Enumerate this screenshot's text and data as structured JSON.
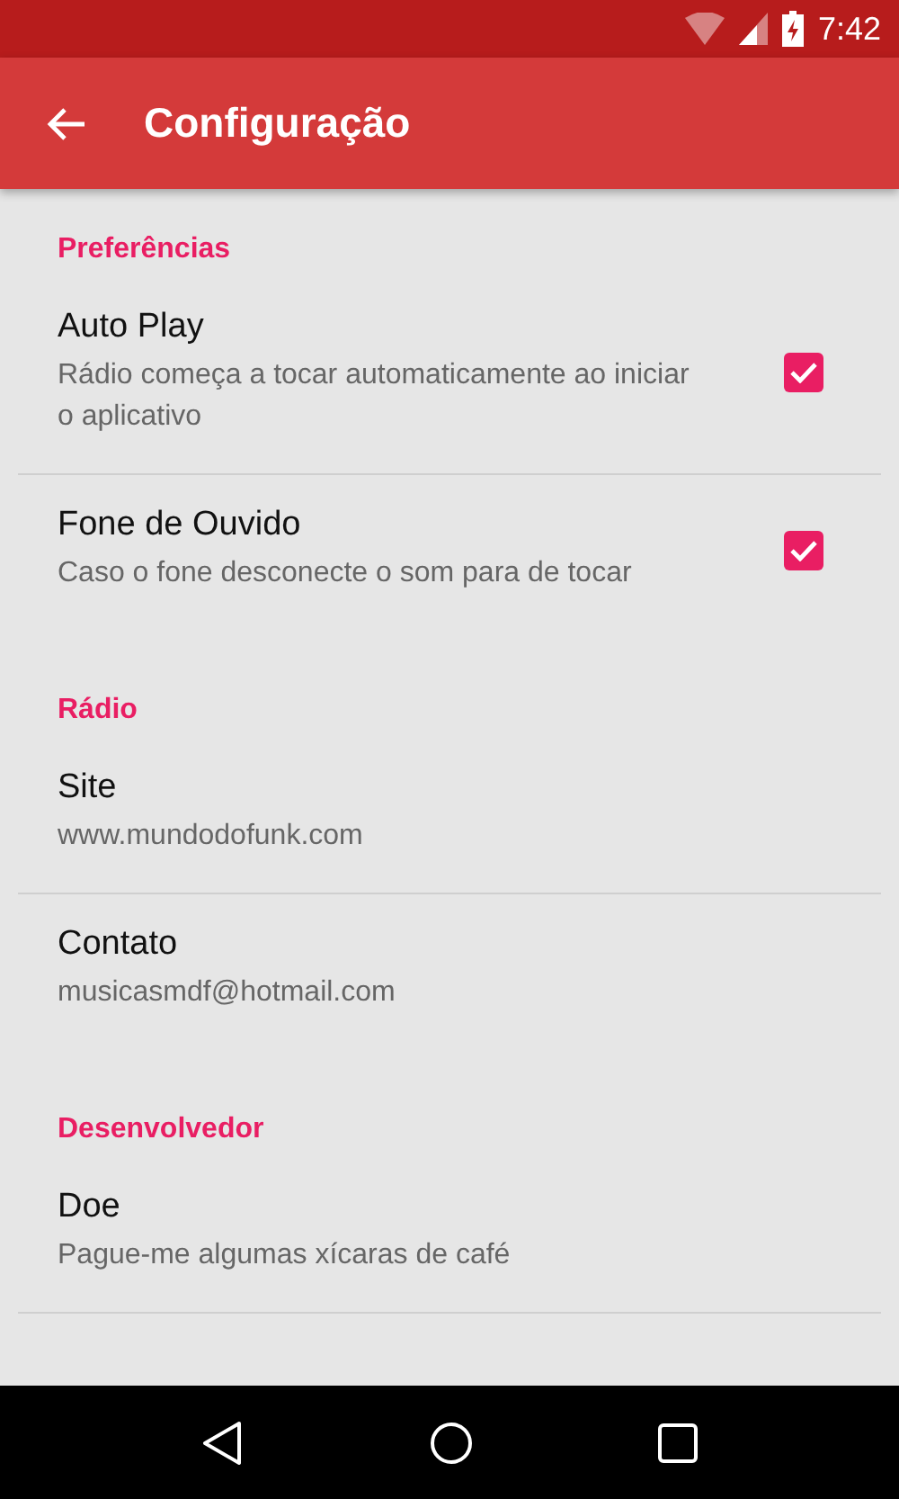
{
  "status_bar": {
    "time": "7:42"
  },
  "toolbar": {
    "title": "Configuração"
  },
  "sections": [
    {
      "title": "Preferências",
      "items": [
        {
          "kind": "checkbox",
          "title": "Auto Play",
          "summary": "Rádio começa a tocar automaticamente ao iniciar o aplicativo",
          "checked": true
        },
        {
          "kind": "checkbox",
          "title": "Fone de Ouvido",
          "summary": "Caso o fone desconecte o som para de tocar",
          "checked": true
        }
      ]
    },
    {
      "title": "Rádio",
      "items": [
        {
          "kind": "text",
          "title": "Site",
          "summary": "www.mundodofunk.com"
        },
        {
          "kind": "text",
          "title": "Contato",
          "summary": "musicasmdf@hotmail.com"
        }
      ]
    },
    {
      "title": "Desenvolvedor",
      "items": [
        {
          "kind": "text",
          "title": "Doe",
          "summary": "Pague-me algumas xícaras de café"
        }
      ]
    }
  ]
}
